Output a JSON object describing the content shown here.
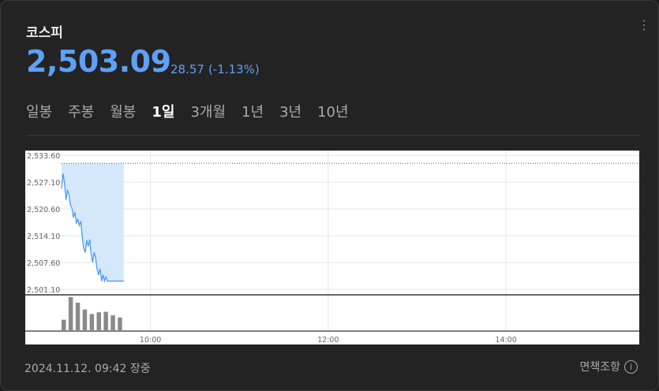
{
  "header": {
    "title": "코스피",
    "price": "2,503.09",
    "change": "28.57",
    "change_pct": "(-1.13%)",
    "change_color": "#5ea0f6",
    "more_icon": "more-vertical-icon"
  },
  "tabs": [
    "일봉",
    "주봉",
    "월봉",
    "1일",
    "3개월",
    "1년",
    "3년",
    "10년"
  ],
  "active_tab": "1일",
  "footer": {
    "timestamp": "2024.11.12. 09:42 장중",
    "disclaimer": "면책조항",
    "info_icon": "info-circle-icon"
  },
  "chart_data": {
    "type": "area",
    "y_ticks": [
      "2,533.60",
      "2,527.10",
      "2,520.60",
      "2,514.10",
      "2,507.60",
      "2,501.10"
    ],
    "y_tick_values": [
      2533.6,
      2527.1,
      2520.6,
      2514.1,
      2507.6,
      2501.1
    ],
    "x_ticks": [
      "10:00",
      "12:00",
      "14:00"
    ],
    "x_range": [
      "09:00",
      "15:30"
    ],
    "prev_close": 2531.66,
    "price_series": {
      "x": [
        "09:00",
        "09:01",
        "09:02",
        "09:03",
        "09:04",
        "09:05",
        "09:06",
        "09:07",
        "09:08",
        "09:09",
        "09:10",
        "09:11",
        "09:12",
        "09:13",
        "09:14",
        "09:15",
        "09:16",
        "09:17",
        "09:18",
        "09:19",
        "09:20",
        "09:21",
        "09:22",
        "09:23",
        "09:24",
        "09:25",
        "09:26",
        "09:27",
        "09:28",
        "09:29",
        "09:30",
        "09:31",
        "09:32",
        "09:33",
        "09:34",
        "09:35",
        "09:36",
        "09:37",
        "09:38",
        "09:39",
        "09:40",
        "09:41",
        "09:42"
      ],
      "values": [
        2525.5,
        2529.2,
        2526.8,
        2522.8,
        2525.2,
        2524.0,
        2521.5,
        2520.8,
        2518.5,
        2519.8,
        2517.2,
        2518.0,
        2516.6,
        2517.6,
        2513.6,
        2511.0,
        2510.0,
        2513.0,
        2511.5,
        2513.2,
        2509.6,
        2507.6,
        2510.1,
        2508.6,
        2505.9,
        2504.6,
        2506.1,
        2503.1,
        2504.6,
        2503.1,
        2504.1,
        2503.1,
        2503.1,
        2503.1,
        2503.1,
        2503.1,
        2503.1,
        2503.1,
        2503.1,
        2503.1,
        2503.1,
        2503.1,
        2503.09
      ]
    },
    "volume": [
      20,
      60,
      50,
      38,
      30,
      33,
      34,
      28,
      24
    ],
    "line_color": "#4a9df0",
    "fill_color": "#d4e7fb",
    "volume_color": "#8a8a8a",
    "grid": true
  }
}
